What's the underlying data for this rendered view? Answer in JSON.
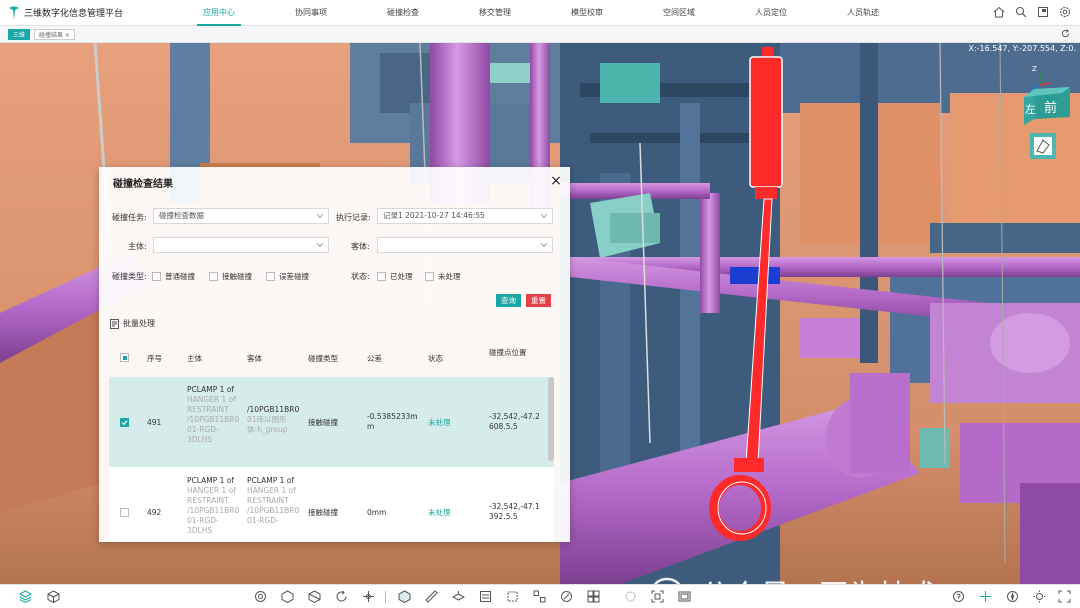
{
  "app": {
    "title": "三维数字化信息管理平台"
  },
  "nav": {
    "items": [
      {
        "label": "应用中心",
        "active": true
      },
      {
        "label": "协同事项"
      },
      {
        "label": "碰撞检查"
      },
      {
        "label": "移交管理"
      },
      {
        "label": "模型校审"
      },
      {
        "label": "空间区域"
      },
      {
        "label": "人员定位"
      },
      {
        "label": "人员轨迹"
      }
    ]
  },
  "tabs": [
    {
      "label": "三维",
      "active": true
    },
    {
      "label": "碰撞结果 ×"
    }
  ],
  "viewport": {
    "coords": "X:-16.547, Y:-207.554, Z:0.",
    "viewcube": {
      "left_face": "左",
      "front_face": "前",
      "axis_z": "Z"
    }
  },
  "panel": {
    "title": "碰撞检查结果",
    "filters": {
      "task_label": "碰撞任务:",
      "task_value": "碰撞检查数据",
      "exec_label": "执行记录:",
      "exec_value": "记录1 2021-10-27 14:46:55",
      "main_label": "主体:",
      "main_value": "",
      "guest_label": "客体:",
      "guest_value": "",
      "type_label": "碰撞类型:",
      "types": [
        "普通碰撞",
        "接触碰撞",
        "误差碰撞"
      ],
      "status_label": "状态:",
      "statuses": [
        "已处理",
        "未处理"
      ],
      "query": "查询",
      "reset": "重置"
    },
    "batch": "批量处理",
    "columns": [
      "序号",
      "主体",
      "客体",
      "碰撞类型",
      "公差",
      "状态",
      "碰撞点位置"
    ],
    "rows": [
      {
        "checked": true,
        "index": "491",
        "main_lines": [
          "PCLAMP 1 of",
          "HANGER 1 of",
          "RESTRAINT",
          "/10PGB11BR0",
          "01-RGD-",
          "3DLHS"
        ],
        "guest_lines": [
          "/10PGB11BR0",
          "01库以图形",
          "体-h_group"
        ],
        "type": "接触碰撞",
        "tolerance_lines": [
          "-0.5385233m",
          "m"
        ],
        "status": "未处理",
        "position_lines": [
          "-32,542,-47.2",
          "608.5.5"
        ]
      },
      {
        "checked": false,
        "index": "492",
        "main_lines": [
          "PCLAMP 1 of",
          "HANGER 1 of",
          "RESTRAINT",
          "/10PGB11BR0",
          "01-RGD-",
          "3DLHS"
        ],
        "guest_lines": [
          "PCLAMP 1 of",
          "HANGER 1 of",
          "RESTRAINT",
          "/10PGB11BR0",
          "01-RGD-"
        ],
        "type": "接触碰撞",
        "tolerance_lines": [
          "0mm"
        ],
        "status": "未处理",
        "position_lines": [
          "-32,542,-47.1",
          "392.5.5"
        ]
      }
    ]
  },
  "watermark": {
    "text": "公众号 · 图为技术"
  },
  "colors": {
    "accent": "#1aa7a5",
    "danger": "#e5414a",
    "clash_red": "#ff2a2a",
    "pipe_purple": "#b36bc4"
  }
}
